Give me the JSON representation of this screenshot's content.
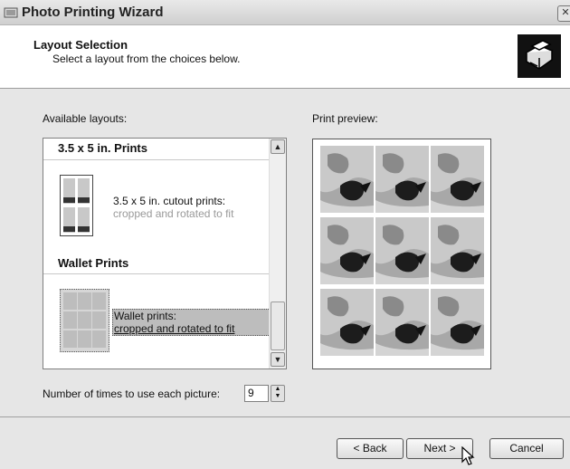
{
  "window": {
    "title": "Photo Printing Wizard",
    "close_glyph": "✕"
  },
  "header": {
    "title": "Layout Selection",
    "subtitle": "Select a layout from the choices below.",
    "icon": "printer-icon"
  },
  "layouts": {
    "label": "Available layouts:",
    "groups": [
      {
        "title": "3.5 x 5 in. Prints",
        "items": [
          {
            "line1": "3.5 x 5 in. cutout prints:",
            "line2": "cropped and rotated to fit",
            "selected": false
          }
        ]
      },
      {
        "title": "Wallet Prints",
        "items": [
          {
            "line1": "Wallet prints:",
            "line2": "cropped and rotated to fit",
            "selected": true
          }
        ]
      }
    ]
  },
  "preview": {
    "label": "Print preview:",
    "rows": 3,
    "cols": 3
  },
  "copies": {
    "label": "Number of times to use each picture:",
    "value": "9"
  },
  "buttons": {
    "back": "< Back",
    "next": "Next >",
    "cancel": "Cancel"
  }
}
